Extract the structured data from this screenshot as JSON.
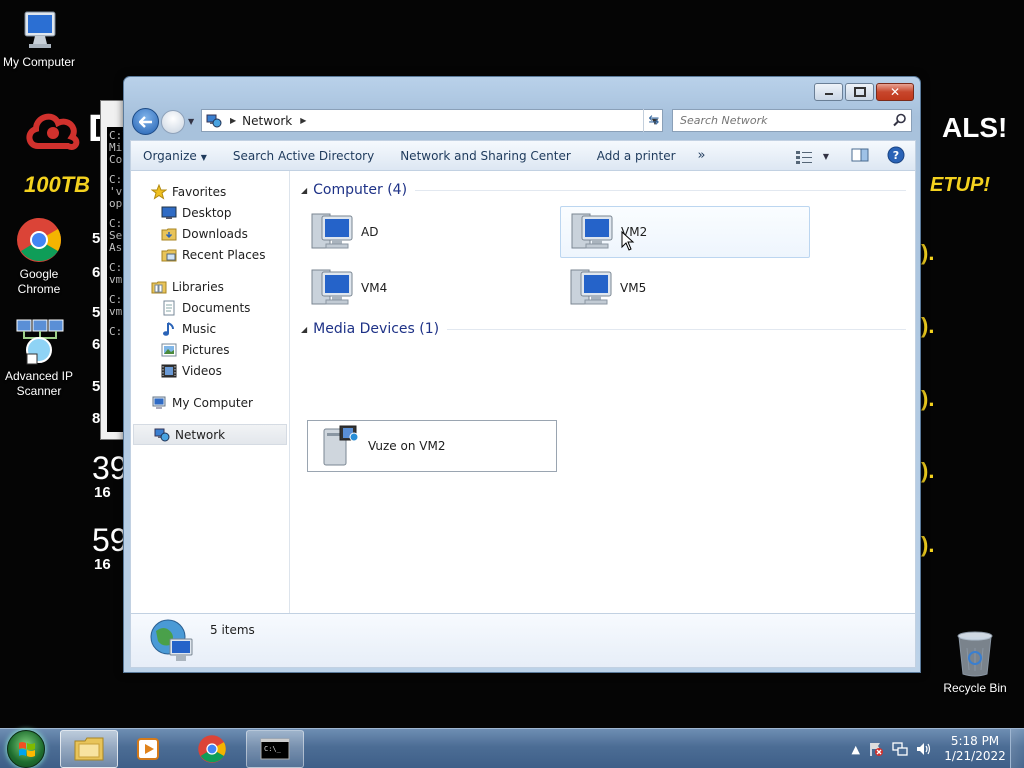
{
  "desktop": {
    "icons": [
      {
        "label": "My Computer",
        "icon": "computer-icon"
      },
      {
        "label": "Google Chrome",
        "icon": "chrome-icon"
      },
      {
        "label": "Advanced IP Scanner",
        "icon": "ip-scanner-icon"
      },
      {
        "label": "Recycle Bin",
        "icon": "recycle-bin-icon"
      }
    ],
    "wallpaper": {
      "brand_letter": "D",
      "tagline_left": "100TB",
      "headline_right": "ALS!",
      "sub_right": "ETUP!",
      "nums": [
        "39",
        "59"
      ],
      "small_nums": [
        "16",
        "16"
      ],
      "colors": {
        "accent_red": "#d0312d",
        "accent_yellow": "#f4d21f"
      }
    },
    "cmd_snippet": [
      "C:\\",
      "Mi",
      "Co",
      "C:",
      "'v",
      "op",
      "C:",
      "Se",
      "As",
      "C:",
      "vm",
      "C:",
      "vm",
      "C:"
    ]
  },
  "explorer": {
    "address": {
      "root_icon": "network-icon",
      "crumb": "Network"
    },
    "search": {
      "placeholder": "Search Network"
    },
    "commands": {
      "organize": "Organize",
      "search_ad": "Search Active Directory",
      "network_center": "Network and Sharing Center",
      "add_printer": "Add a printer",
      "more": "»"
    },
    "nav": {
      "favorites": "Favorites",
      "desktop": "Desktop",
      "downloads": "Downloads",
      "recent": "Recent Places",
      "libraries": "Libraries",
      "documents": "Documents",
      "music": "Music",
      "pictures": "Pictures",
      "videos": "Videos",
      "my_computer": "My Computer",
      "network": "Network"
    },
    "groups": {
      "computer": {
        "title": "Computer (4)",
        "items": [
          "AD",
          "VM2",
          "VM4",
          "VM5"
        ]
      },
      "media": {
        "title": "Media Devices (1)",
        "items": [
          "Vuze on VM2"
        ]
      }
    },
    "details": {
      "count": "5 items"
    }
  },
  "taskbar": {
    "clock_time": "5:18 PM",
    "clock_date": "1/21/2022"
  }
}
